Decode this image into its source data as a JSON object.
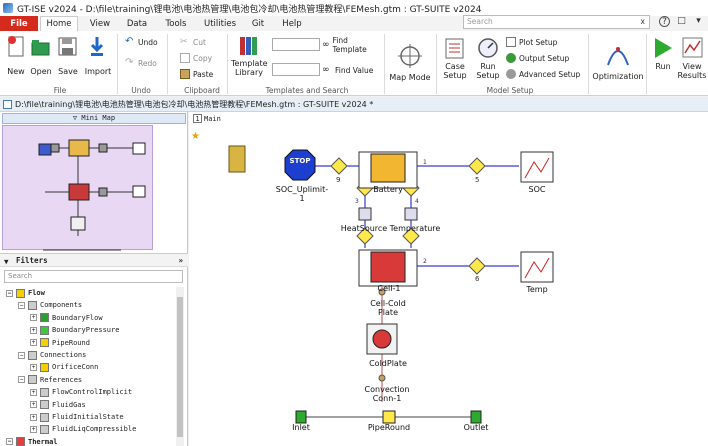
{
  "window": {
    "title": "GT-ISE v2024 - D:\\file\\training\\锂电池\\电池热管理\\电池包冷却\\电池热管理教程\\FEMesh.gtm : GT-SUITE v2024"
  },
  "tabs": [
    "File",
    "Home",
    "View",
    "Data",
    "Tools",
    "Utilities",
    "Git",
    "Help"
  ],
  "search": {
    "placeholder": "Search",
    "clear": "x"
  },
  "toolbar_icons": {
    "help": "?",
    "doc": "□",
    "dropdown": "▾"
  },
  "ribbon": {
    "file_group": {
      "label": "File",
      "new": "New",
      "open": "Open",
      "save": "Save",
      "import": "Import"
    },
    "undo_group": {
      "label": "Undo",
      "undo": "Undo",
      "redo": "Redo"
    },
    "clipboard_group": {
      "label": "Clipboard",
      "cut": "Cut",
      "copy": "Copy",
      "paste": "Paste"
    },
    "templates_group": {
      "label": "Templates and Search",
      "template_library": "Template Library",
      "find_template": "Find Template",
      "find_value": "Find Value"
    },
    "map_mode": "Map Mode",
    "model_setup_group": {
      "label": "Model Setup",
      "case_setup": "Case Setup",
      "run_setup": "Run Setup",
      "plot_setup": "Plot Setup",
      "output_setup": "Output Setup",
      "advanced_setup": "Advanced Setup"
    },
    "optimization": "Optimization",
    "run": "Run",
    "view_results": "View Results"
  },
  "pathbar": {
    "text": "D:\\file\\training\\锂电池\\电池热管理\\电池包冷却\\电池热管理教程\\FEMesh.gtm : GT-SUITE v2024 *"
  },
  "left_panel": {
    "minimap_title": "Mini Map",
    "filters_title": "Filters",
    "filter_search_placeholder": "Search",
    "tree": [
      {
        "label": "Flow",
        "level": 0,
        "bold": true,
        "expanded": true,
        "icon_color": "#f4d000"
      },
      {
        "label": "Components",
        "level": 1,
        "expanded": true,
        "icon_color": "#cccccc"
      },
      {
        "label": "BoundaryFlow",
        "level": 2,
        "icon_color": "#2e9e2e"
      },
      {
        "label": "BoundaryPressure",
        "level": 2,
        "icon_color": "#3cc83c"
      },
      {
        "label": "PipeRound",
        "level": 2,
        "icon_color": "#f4d000"
      },
      {
        "label": "Connections",
        "level": 1,
        "expanded": true,
        "icon_color": "#cccccc"
      },
      {
        "label": "OrificeConn",
        "level": 2,
        "icon_color": "#f4d000"
      },
      {
        "label": "References",
        "level": 1,
        "expanded": true,
        "icon_color": "#cccccc"
      },
      {
        "label": "FlowControlImplicit",
        "level": 2,
        "icon_color": "#cccccc"
      },
      {
        "label": "FluidGas",
        "level": 2,
        "icon_color": "#cccccc"
      },
      {
        "label": "FluidInitialState",
        "level": 2,
        "icon_color": "#cccccc"
      },
      {
        "label": "FluidLiqCompressible",
        "level": 2,
        "icon_color": "#cccccc"
      },
      {
        "label": "Thermal",
        "level": 0,
        "bold": true,
        "expanded": true,
        "icon_color": "#e04040"
      }
    ]
  },
  "canvas": {
    "tab_number": "1",
    "tab_label": "Main",
    "components": {
      "stop": "STOP",
      "soc_uplimit": "SOC_Uplimit-\n1",
      "battery": "Battery",
      "soc": "SOC",
      "heat_source": "HeatSource",
      "temperature": "Temperature",
      "temp": "Temp",
      "cell1": "Cell-1",
      "cell_cold_plate": "Cell-Cold\nPlate",
      "cold_plate": "ColdPlate",
      "convection_conn": "Convection\nConn-1",
      "inlet": "Inlet",
      "pipe_round": "PipeRound",
      "outlet": "Outlet"
    },
    "conn_numbers": {
      "n9": "9",
      "n5": "5",
      "n6": "6",
      "n1": "1",
      "n2": "2",
      "n3": "3",
      "n4": "4"
    }
  }
}
